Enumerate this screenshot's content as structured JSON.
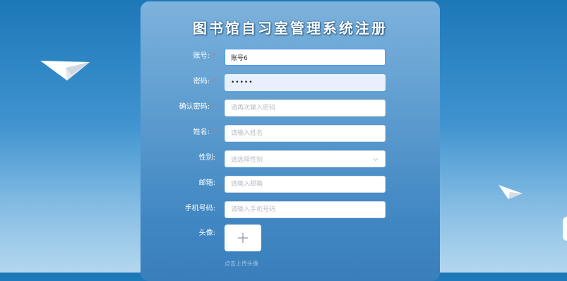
{
  "title": "图书馆自习室管理系统注册",
  "form": {
    "fields": [
      {
        "label": "账号:",
        "required": true,
        "value": "账号6",
        "placeholder": ""
      },
      {
        "label": "密码:",
        "required": true,
        "value": "•••••",
        "placeholder": ""
      },
      {
        "label": "确认密码:",
        "required": true,
        "value": "",
        "placeholder": "请再次输入密码"
      },
      {
        "label": "姓名:",
        "required": true,
        "value": "",
        "placeholder": "请输入姓名"
      },
      {
        "label": "性别:",
        "required": false,
        "value": "",
        "placeholder": "请选择性别"
      },
      {
        "label": "邮箱:",
        "required": false,
        "value": "",
        "placeholder": "请输入邮箱"
      },
      {
        "label": "手机号码:",
        "required": false,
        "value": "",
        "placeholder": "请输入手机号码"
      }
    ],
    "avatar": {
      "label": "头像:",
      "hint": "点击上传头像"
    },
    "required_mark": "*"
  },
  "icons": {
    "upload": "plus-icon",
    "select": "chevron-down-icon",
    "decor": "paper-plane-icon"
  },
  "colors": {
    "accent": "#409eff",
    "required": "#ff5b5b",
    "card": "#5d9ccf"
  }
}
